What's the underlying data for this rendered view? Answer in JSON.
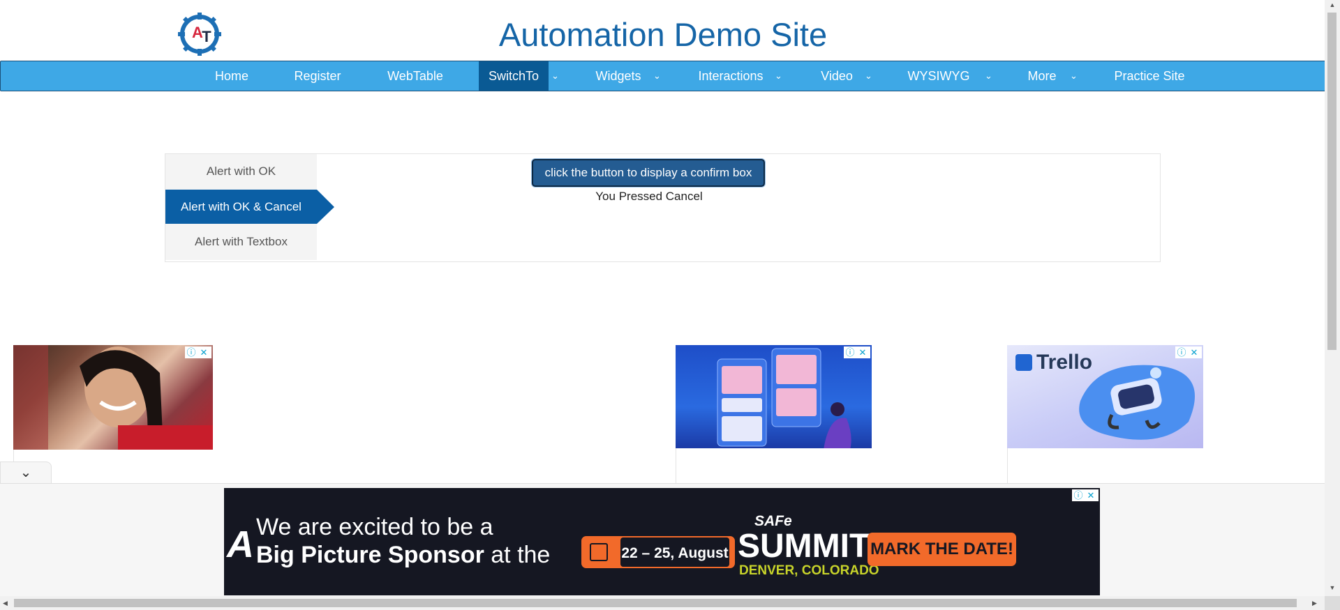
{
  "header": {
    "logo_letters": "AT",
    "title": "Automation Demo Site"
  },
  "nav": {
    "items": [
      {
        "label": "Home",
        "dropdown": false
      },
      {
        "label": "Register",
        "dropdown": false
      },
      {
        "label": "WebTable",
        "dropdown": false
      },
      {
        "label": "SwitchTo",
        "dropdown": true,
        "active": true
      },
      {
        "label": "Widgets",
        "dropdown": true
      },
      {
        "label": "Interactions",
        "dropdown": true
      },
      {
        "label": "Video",
        "dropdown": true
      },
      {
        "label": "WYSIWYG",
        "dropdown": true
      },
      {
        "label": "More",
        "dropdown": true
      },
      {
        "label": "Practice Site",
        "dropdown": false
      }
    ],
    "chevron_icon": "chevron-down-icon",
    "bar_color": "#3ea8e6",
    "active_color": "#0a5a94"
  },
  "alerts": {
    "tabs": [
      {
        "label": "Alert with OK",
        "active": false
      },
      {
        "label": "Alert with OK & Cancel",
        "active": true
      },
      {
        "label": "Alert with Textbox",
        "active": false
      }
    ],
    "button_label": "click the button to display a confirm box",
    "result_text": "You Pressed Cancel"
  },
  "ads": {
    "ad_choice_icons": [
      "info-icon",
      "close-icon"
    ],
    "trello_label": "Trello"
  },
  "sticky_ad": {
    "line1": "We are excited to be a",
    "line2_bold": "Big Picture Sponsor",
    "line2_rest": " at the",
    "dates": "22 – 25, August",
    "safe": "SAFe",
    "summit": "SUMMIT",
    "location": "DENVER, COLORADO",
    "cta": "MARK THE DATE!",
    "accent": "#f26a2a"
  }
}
